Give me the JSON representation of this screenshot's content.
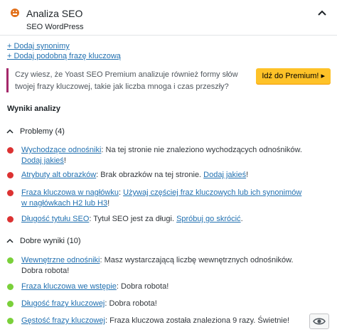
{
  "header": {
    "title": "Analiza SEO",
    "subtitle": "SEO WordPress"
  },
  "links": {
    "add_synonyms": "+ Dodaj synonimy",
    "add_related": "+ Dodaj podobną frazę kluczową"
  },
  "promo": {
    "text": "Czy wiesz, że Yoast SEO Premium analizuje również formy słów twojej frazy kluczowej, takie jak liczba mnoga i czas przeszły?",
    "button": "Idź do Premium! ▸"
  },
  "results": {
    "heading": "Wyniki analizy",
    "colors": {
      "bad": "#dc3232",
      "good": "#7ad03a"
    },
    "problems": {
      "label": "Problemy (4)",
      "items": [
        {
          "link": "Wychodzące odnośniki",
          "text": ": Na tej stronie nie znaleziono wychodzących odnośników. ",
          "action": "Dodaj jakieś",
          "end": "!"
        },
        {
          "link": "Atrybuty alt obrazków",
          "text": ": Brak obrazków na tej stronie. ",
          "action": "Dodaj jakieś",
          "end": "!"
        },
        {
          "link": "Fraza kluczowa w nagłówku",
          "text": ": ",
          "action": "Używaj częściej fraz kluczowych lub ich synonimów w nagłówkach H2 lub H3",
          "end": "!"
        },
        {
          "link": "Długość tytułu SEO",
          "text": ": Tytuł SEO jest za długi. ",
          "action": "Spróbuj go skrócić",
          "end": "."
        }
      ]
    },
    "good": {
      "label": "Dobre wyniki (10)",
      "items": [
        {
          "link": "Wewnętrzne odnośniki",
          "text": ": Masz wystarczającą liczbę wewnętrznych odnośników. Dobra robota!"
        },
        {
          "link": "Fraza kluczowa we wstępie",
          "text": ": Dobra robota!"
        },
        {
          "link": "Długość frazy kluczowej",
          "text": ": Dobra robota!"
        },
        {
          "link": "Gęstość frazy kluczowej",
          "text": ": Fraza kluczowa została znaleziona 9 razy. Świetnie!"
        }
      ]
    }
  }
}
